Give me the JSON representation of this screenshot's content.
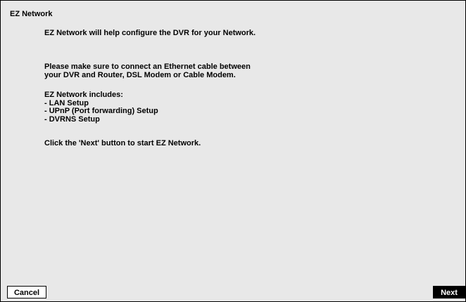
{
  "dialog": {
    "title": "EZ Network",
    "intro": "EZ Network will help configure the DVR for your Network.",
    "connect_lines": [
      "Please make sure to connect an Ethernet cable between",
      "your DVR and Router, DSL Modem or Cable Modem."
    ],
    "includes_heading": "EZ Network includes:",
    "includes_items": [
      "- LAN Setup",
      "- UPnP (Port forwarding) Setup",
      "- DVRNS Setup"
    ],
    "instruction": "Click the 'Next' button to start EZ Network."
  },
  "buttons": {
    "cancel_label": "Cancel",
    "next_label": "Next"
  }
}
